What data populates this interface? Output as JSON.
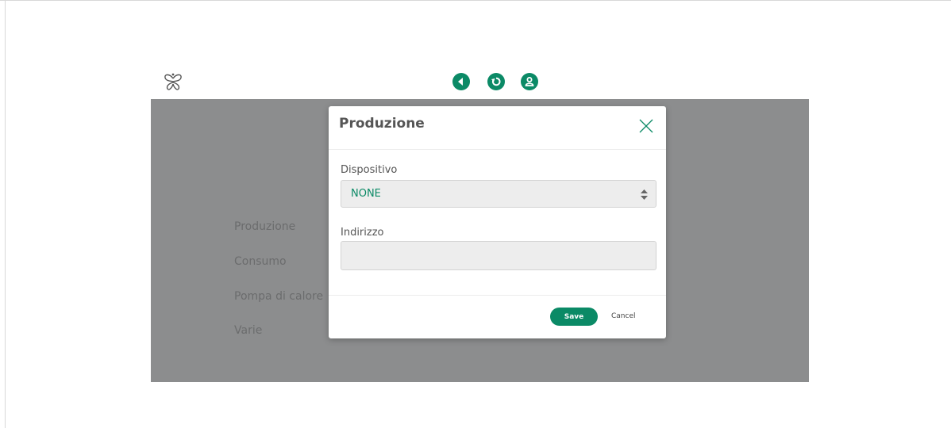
{
  "header": {
    "logo_icon": "butterfly-logo-icon",
    "nav_buttons": [
      {
        "icon": "back-arrow-icon"
      },
      {
        "icon": "refresh-icon"
      },
      {
        "icon": "user-icon"
      }
    ],
    "accent_color": "#0b8a66"
  },
  "background_menu": {
    "items": [
      "Produzione",
      "Consumo",
      "Pompa di calore",
      "Varie"
    ]
  },
  "modal": {
    "title": "Produzione",
    "fields": {
      "device_label": "Dispositivo",
      "device_value": "NONE",
      "address_label": "Indirizzo",
      "address_value": ""
    },
    "save_label": "Save",
    "cancel_label": "Cancel"
  }
}
